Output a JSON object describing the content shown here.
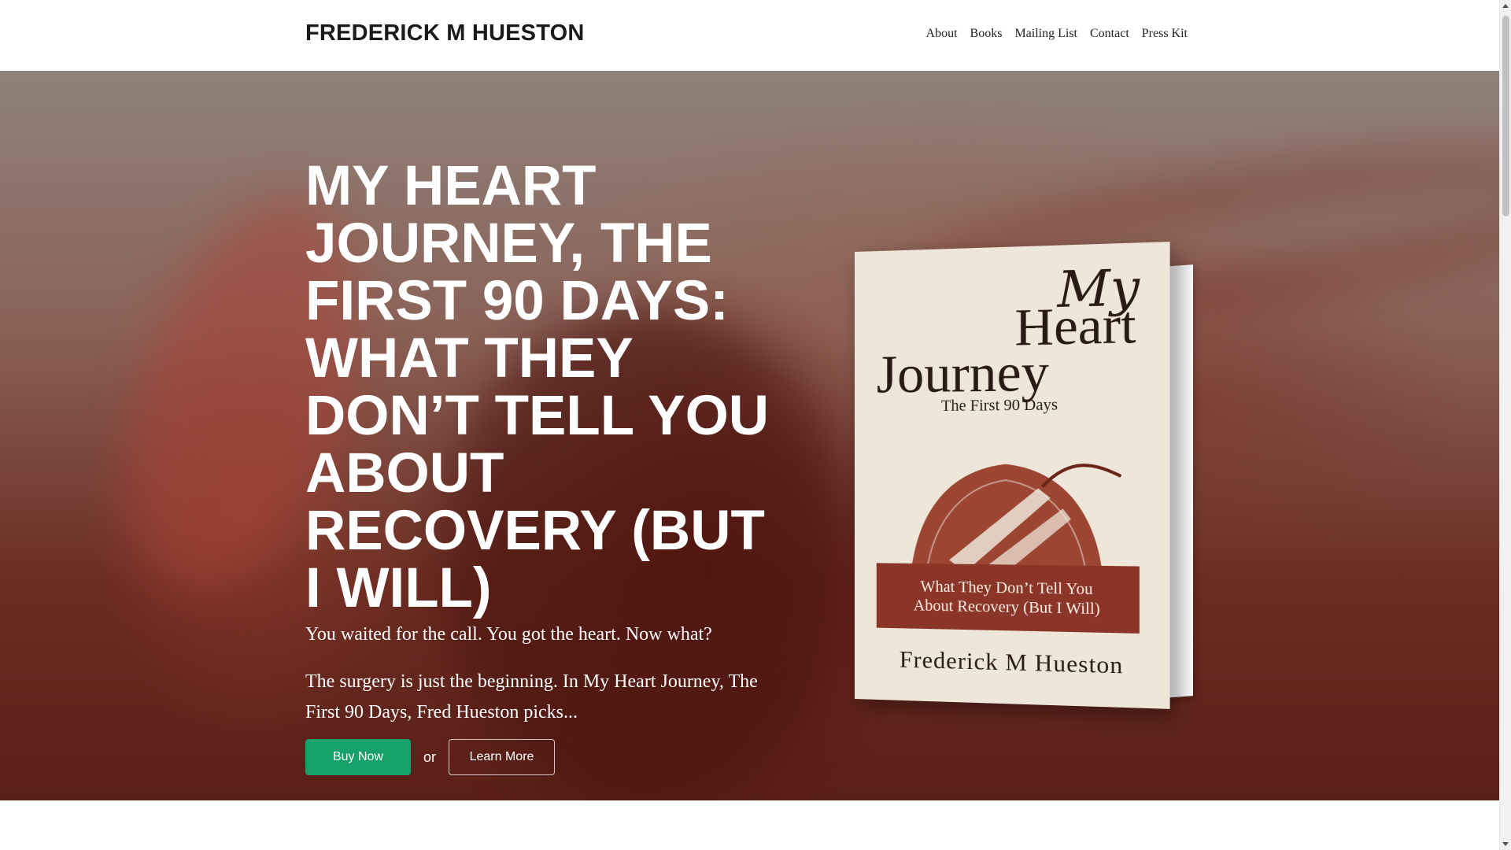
{
  "header": {
    "brand": "FREDERICK M HUESTON",
    "nav": [
      "About",
      "Books",
      "Mailing List",
      "Contact",
      "Press Kit"
    ]
  },
  "hero": {
    "title": "MY HEART JOURNEY, THE FIRST 90 DAYS: WHAT THEY DON’T TELL YOU ABOUT RECOVERY (BUT I WILL)",
    "tagline": "You waited for the call. You got the heart. Now what?",
    "description": "The surgery is just the beginning. In My Heart Journey, The First 90 Days, Fred Hueston picks...",
    "buy_label": "Buy Now",
    "or_label": "or",
    "learn_label": "Learn More"
  },
  "book_cover": {
    "title_my": "My",
    "title_heart": "Heart",
    "title_journey": "Journey",
    "subtitle": "The First 90 Days",
    "banner_line1": "What They Don’t Tell You",
    "banner_line2": "About Recovery (But I Will)",
    "author": "Frederick M Hueston"
  },
  "colors": {
    "accent_green": "#16a06a",
    "hero_dark_red": "#5a1f18",
    "cover_banner": "#8a3527",
    "cover_paper": "#efe6da"
  }
}
